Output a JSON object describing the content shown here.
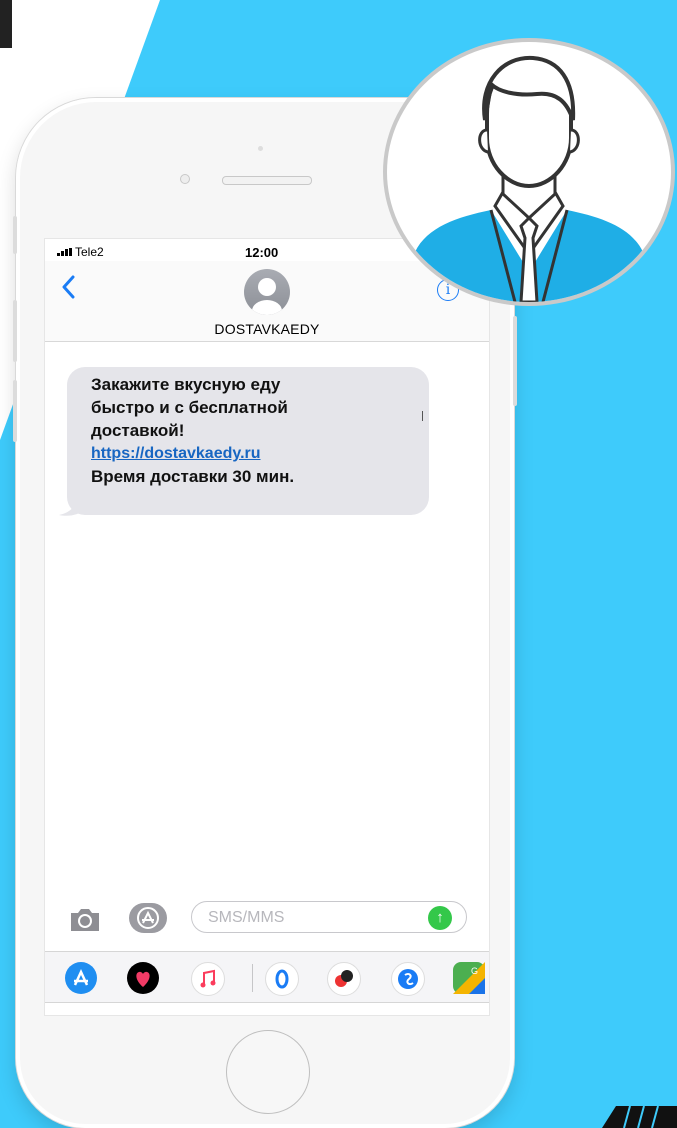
{
  "status_bar": {
    "carrier": "Tele2",
    "time": "12:00"
  },
  "header": {
    "contact_name": "DOSTAVKAEDY"
  },
  "message": {
    "line1": "Закажите вкусную еду",
    "line2": "быстро и с бесплатной",
    "line3": "доставкой!",
    "link": "https://dostavkaedy.ru",
    "line4": "Время доставки 30 мин."
  },
  "input": {
    "placeholder": "SMS/MMS"
  },
  "colors": {
    "background_blue": "#3ecbfb",
    "link_blue": "#1766c2",
    "send_green": "#34c84a",
    "bubble_gray": "#e5e5ea"
  },
  "icons": [
    "back-icon",
    "info-icon",
    "camera-icon",
    "app-store-icon",
    "send-icon",
    "heart-icon",
    "music-icon",
    "ok-icon",
    "translate-icon",
    "shazam-icon",
    "maps-icon",
    "user-avatar-icon"
  ]
}
